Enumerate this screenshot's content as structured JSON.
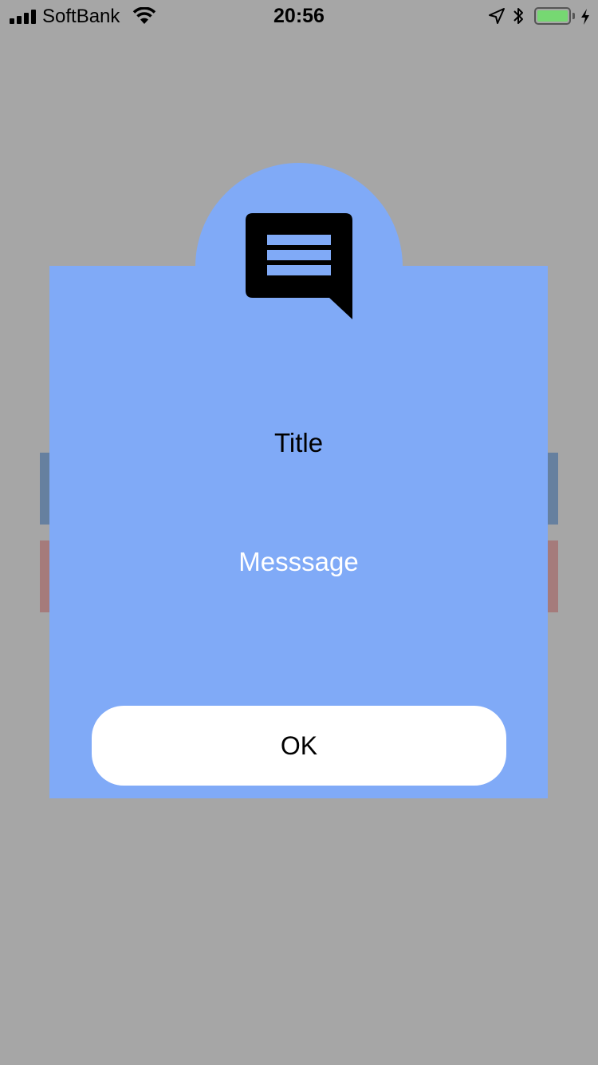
{
  "status_bar": {
    "carrier": "SoftBank",
    "time": "20:56",
    "battery_level": 1.0,
    "icons": [
      "signal-icon",
      "wifi-icon",
      "location-icon",
      "bluetooth-icon",
      "battery-icon",
      "charging-icon"
    ]
  },
  "colors": {
    "overlay": "#a6a6a6",
    "dialog": "#80aaf7",
    "button": "#ffffff",
    "background_button_blue": "#66809f",
    "background_button_red": "#a57b7b",
    "message_text": "#ffffff"
  },
  "dialog": {
    "icon": "message-icon",
    "title": "Title",
    "message": "Messsage",
    "ok_label": "OK"
  }
}
